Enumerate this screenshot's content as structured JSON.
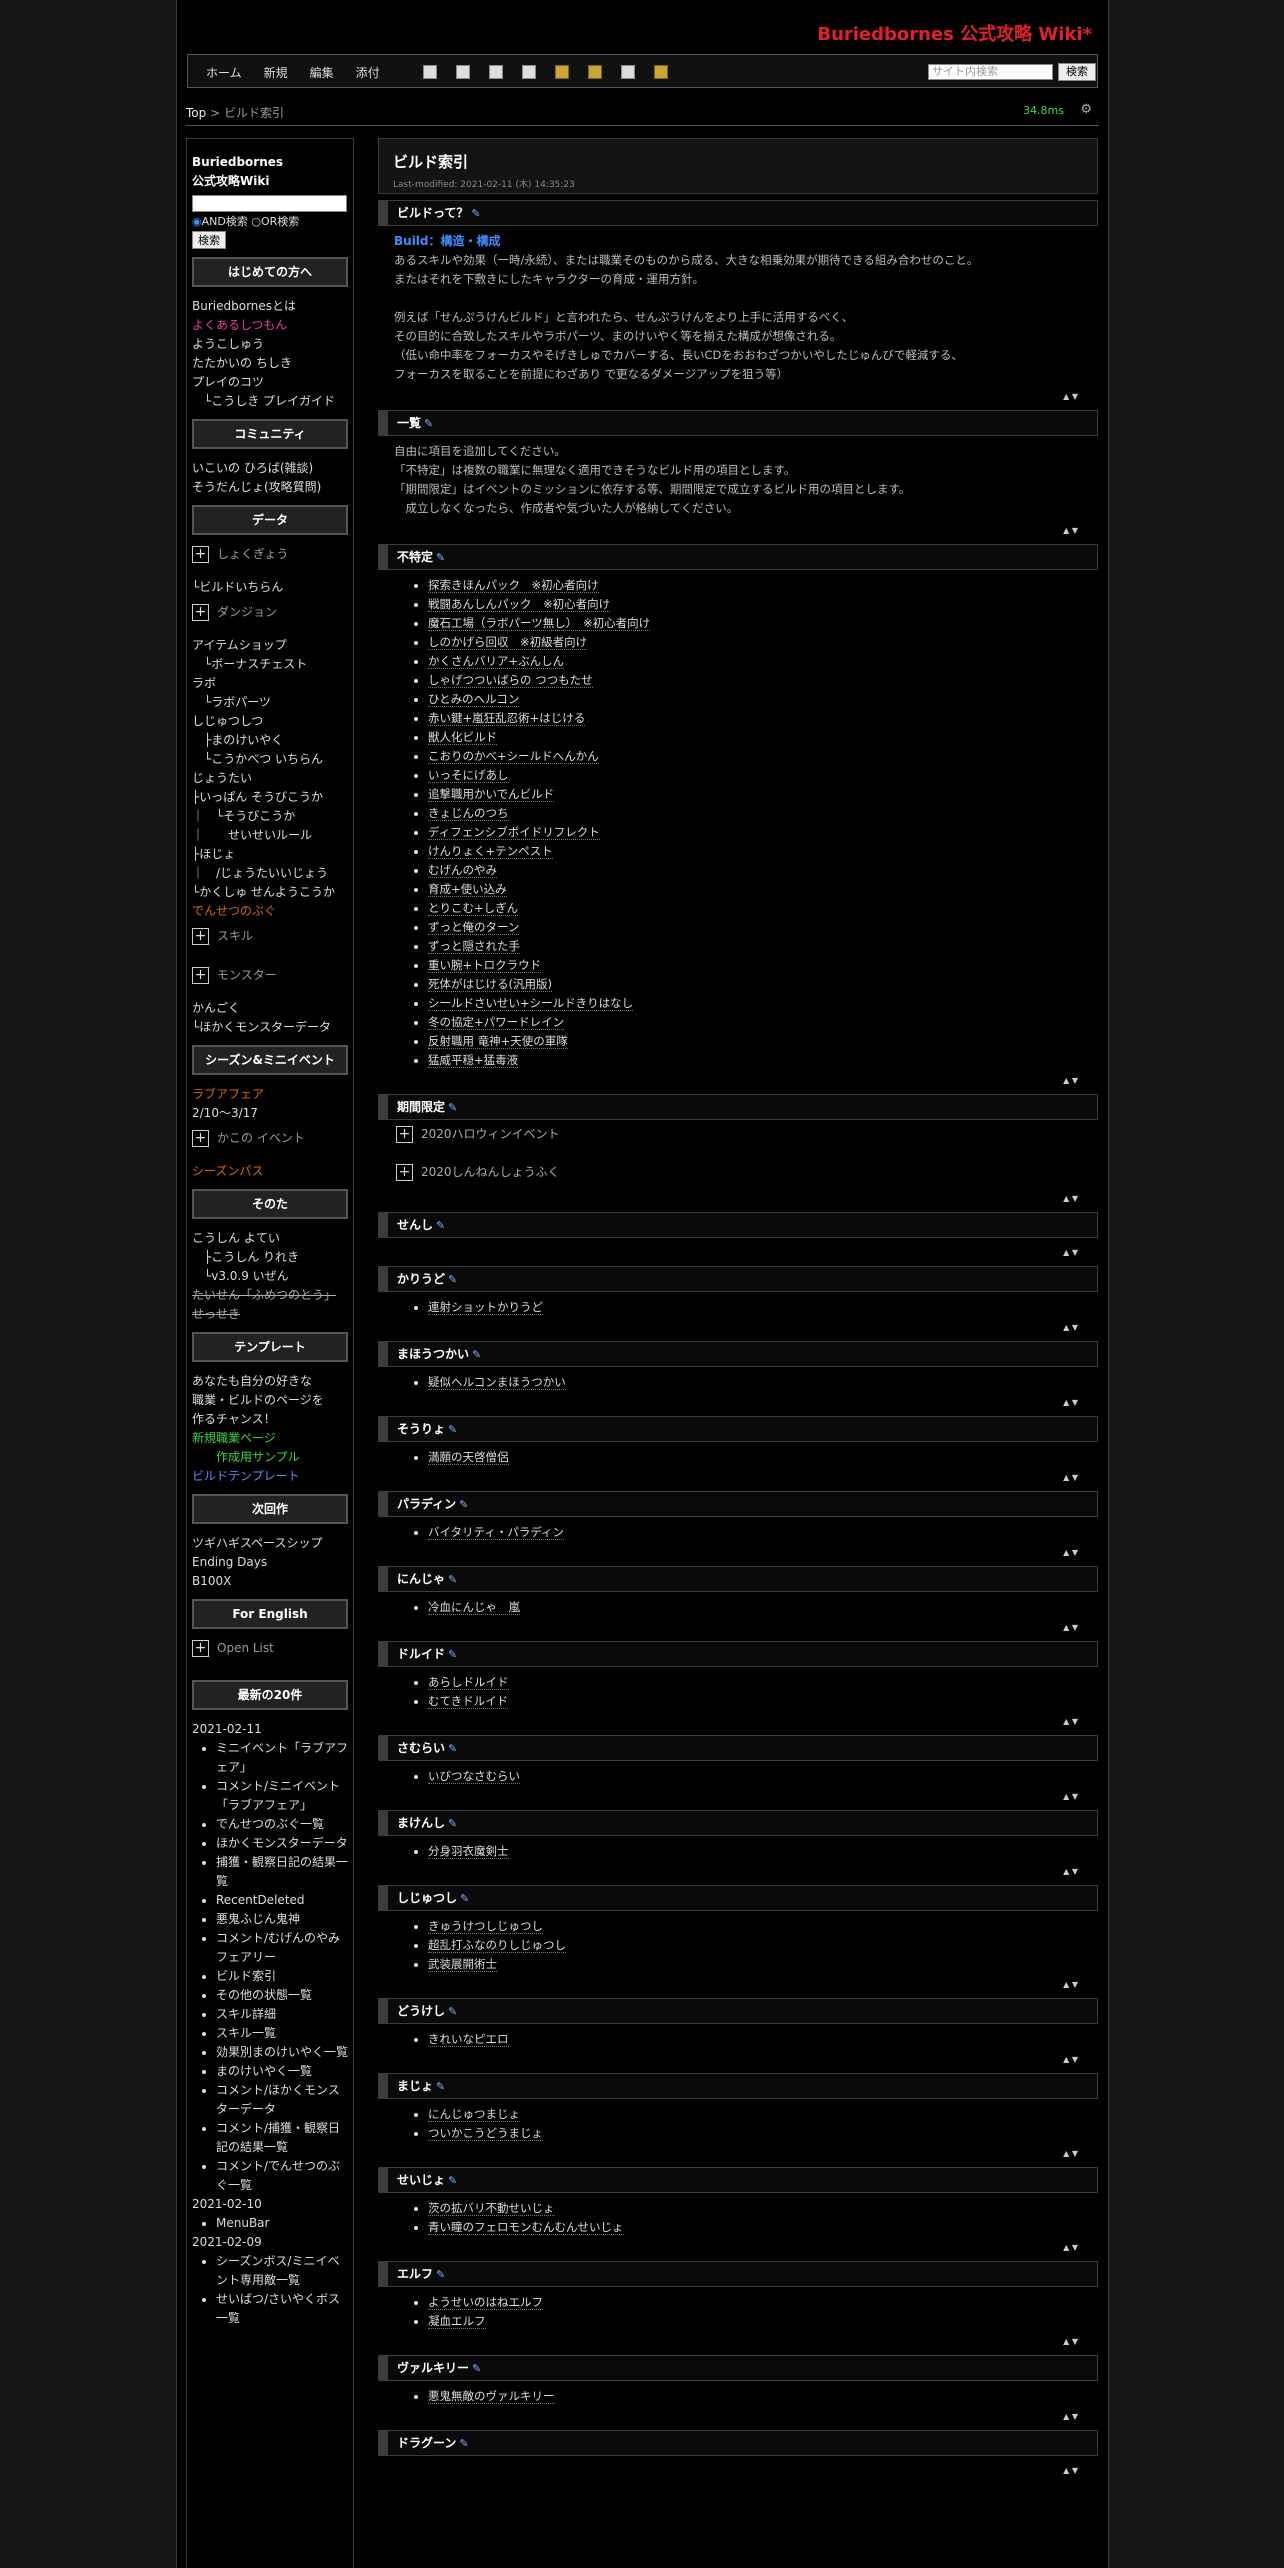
{
  "site_title": "Buriedbornes 公式攻略 Wiki*",
  "nav": {
    "links": [
      "ホーム",
      "新規",
      "編集",
      "添付"
    ],
    "search_placeholder": "サイト内検索",
    "search_button": "検索"
  },
  "breadcrumb": {
    "top": "Top",
    "sep": " > ",
    "current": "ビルド索引"
  },
  "timer": "34.8ms",
  "sidebar": {
    "site_name_1": "Buriedbornes",
    "site_name_2": "公式攻略Wiki",
    "and_label": "AND検索",
    "or_label": "OR検索",
    "search_button": "検索",
    "h_beginner": "はじめての方へ",
    "beginner": [
      "Buriedbornesとは",
      "よくあるしつもん",
      "ようこしゅう",
      "たたかいの ちしき",
      "プレイのコツ",
      "　└こうしき プレイガイド"
    ],
    "h_community": "コミュニティ",
    "community": [
      "いこいの ひろば(雑談)",
      "そうだんじょ(攻略質問)"
    ],
    "h_data": "データ",
    "data_fold1": "しょくぎょう",
    "data_link1": "└ビルドいちらん",
    "data_fold2": "ダンジョン",
    "data_items": [
      "アイテムショップ",
      "　└ボーナスチェスト",
      "ラボ",
      "　└ラボパーツ",
      "しじゅつしつ",
      "　├まのけいやく",
      "　└こうかべつ いちらん",
      "じょうたい",
      "├いっぱん そうびこうか",
      "｜　└そうびこうか",
      "｜　　せいせいルール",
      "├ほじょ",
      "｜　/じょうたいいじょう",
      "└かくしゅ せんようこうか",
      "でんせつのぶぐ"
    ],
    "data_fold3": "スキル",
    "data_fold4": "モンスター",
    "data_items2": [
      "かんごく",
      "└ほかくモンスターデータ"
    ],
    "h_season": "シーズン&ミニイベント",
    "season_event": "ラブアフェア",
    "season_date": "2/10～3/17",
    "season_fold": "かこの イベント",
    "season_pass": "シーズンパス",
    "h_other": "そのた",
    "other": [
      "こうしん よてい",
      "　├こうしん りれき",
      "　└v3.0.9 いぜん",
      "たいせん「ふめつのとう」",
      "せっせき"
    ],
    "h_template": "テンプレート",
    "template": [
      "あなたも自分の好きな",
      "職業・ビルドのページを",
      "作るチャンス！",
      "新規職業ページ",
      "　　作成用サンプル",
      "ビルドテンプレート"
    ],
    "h_next": "次回作",
    "next": [
      "ツギハギスペースシップ",
      "Ending Days",
      "B100X"
    ],
    "h_english": "For English",
    "english_fold": "Open List",
    "h_recent": "最新の20件",
    "recent": [
      {
        "date": "2021-02-11",
        "items": [
          "ミニイベント「ラブアフェア」",
          "コメント/ミニイベント「ラブアフェア」",
          "でんせつのぶぐ一覧",
          "ほかくモンスターデータ",
          "捕獲・観察日記の結果一覧",
          "RecentDeleted",
          "悪鬼ふじん鬼神",
          "コメント/むげんのやみフェアリー",
          "ビルド索引",
          "その他の状態一覧",
          "スキル詳細",
          "スキル一覧",
          "効果別まのけいやく一覧",
          "まのけいやく一覧",
          "コメント/ほかくモンスターデータ",
          "コメント/捕獲・観察日記の結果一覧",
          "コメント/でんせつのぶぐ一覧"
        ]
      },
      {
        "date": "2021-02-10",
        "items": [
          "MenuBar"
        ]
      },
      {
        "date": "2021-02-09",
        "items": [
          "シーズンボス/ミニイベント専用敵一覧",
          "せいばつ/さいやくボス一覧"
        ]
      }
    ]
  },
  "main": {
    "title": "ビルド索引",
    "last_modified": "Last-modified: 2021-02-11 (木) 14:35:23",
    "s_what": "ビルドって？",
    "build_label": "Build：構造・構成",
    "what_lines": [
      "あるスキルや効果（一時/永続）、または職業そのものから成る、大きな相乗効果が期待できる組み合わせのこと。",
      "またはそれを下敷きにしたキャラクターの育成・運用方針。",
      "",
      "例えば「せんぷうけんビルド」と言われたら、せんぷうけんをより上手に活用するべく、",
      "その目的に合致したスキルやラボパーツ、まのけいやく等を揃えた構成が想像される。",
      "（低い命中率をフォーカスやそげきしゅでカバーする、長いCDをおおわざつかいやしたじゅんびで軽減する、",
      "フォーカスを取ることを前提にわざあり で更なるダメージアップを狙う等）"
    ],
    "s_list": "一覧",
    "list_lines": [
      "自由に項目を追加してください。",
      "「不特定」は複数の職業に無理なく適用できそうなビルド用の項目とします。",
      "「期間限定」はイベントのミッションに依存する等、期間限定で成立するビルド用の項目とします。",
      "　成立しなくなったら、作成者や気づいた人が格納してください。"
    ],
    "s_unspecified": "不特定",
    "unspecified": [
      "探索きほんパック　※初心者向け",
      "戦闘あんしんパック　※初心者向け",
      "魔石工場（ラボパーツ無し）　※初心者向け",
      "しのかげら回収　※初級者向け",
      "かくさんバリア+ぶんしん",
      "しゃげつついばらの つつもたせ",
      "ひとみのヘルコン",
      "赤い鍵+嵐狂乱忍術+はじける",
      "獣人化ビルド",
      "こおりのかべ+シールドへんかん",
      "いっそにげあし",
      "追撃職用かいでんビルド",
      "きょじんのつち",
      "ディフェンシブボイドリフレクト",
      "けんりょく+テンペスト",
      "むげんのやみ",
      "育成+使い込み",
      "とりこむ+しぎん",
      "ずっと俺のターン",
      "ずっと隠された手",
      "重い腕+トロクラウド",
      "死体がはじける(汎用版)",
      "シールドさいせい+シールドきりはなし",
      "冬の協定+パワードレイン",
      "反射職用 竜神+天使の軍隊",
      "猛威平穏+猛毒液"
    ],
    "s_limited": "期間限定",
    "limited_folds": [
      "2020ハロウィンイベント",
      "2020しんねんしょうふく"
    ],
    "jobs": [
      {
        "name": "せんし",
        "items": []
      },
      {
        "name": "かりうど",
        "items": [
          "連射ショットかりうど"
        ]
      },
      {
        "name": "まほうつかい",
        "items": [
          "疑似ヘルコンまほうつかい"
        ]
      },
      {
        "name": "そうりょ",
        "items": [
          "満願の天啓僧侶"
        ]
      },
      {
        "name": "パラディン",
        "items": [
          "バイタリティ・パラディン"
        ]
      },
      {
        "name": "にんじゃ",
        "items": [
          "冷血にんじゃ　嵐"
        ]
      },
      {
        "name": "ドルイド",
        "items": [
          "あらしドルイド",
          "むてきドルイド"
        ]
      },
      {
        "name": "さむらい",
        "items": [
          "いびつなさむらい"
        ]
      },
      {
        "name": "まけんし",
        "items": [
          "分身羽衣魔剣士"
        ]
      },
      {
        "name": "しじゅつし",
        "items": [
          "きゅうけつしじゅつし",
          "超乱打ふなのりしじゅつし",
          "武装展開術士"
        ]
      },
      {
        "name": "どうけし",
        "items": [
          "きれいなピエロ"
        ]
      },
      {
        "name": "まじょ",
        "items": [
          "にんじゅつまじょ",
          "ついかこうどうまじょ"
        ]
      },
      {
        "name": "せいじょ",
        "items": [
          "茨の拡バリ不動せいじょ",
          "青い瞳のフェロモンむんむんせいじょ"
        ]
      },
      {
        "name": "エルフ",
        "items": [
          "ようせいのはねエルフ",
          "凝血エルフ"
        ]
      },
      {
        "name": "ヴァルキリー",
        "items": [
          "悪鬼無敵のヴァルキリー"
        ]
      },
      {
        "name": "ドラグーン",
        "items": []
      }
    ]
  },
  "colors": {
    "title_red": "#e0202a",
    "link_blue": "#3d8fff",
    "timer_green": "#4bd44b",
    "pink": "#e0409a",
    "orange": "#d96a00",
    "lime": "#3fd33f"
  }
}
